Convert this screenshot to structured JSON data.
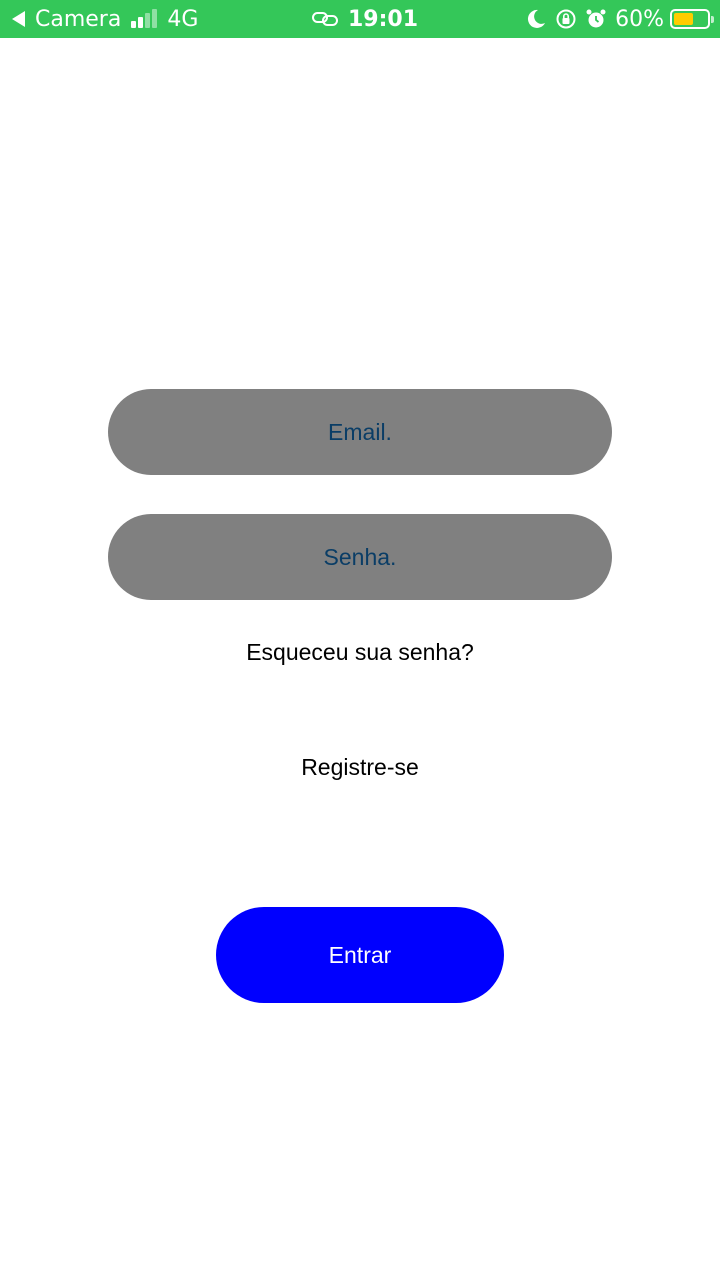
{
  "status_bar": {
    "back_app": "Camera",
    "network": "4G",
    "time": "19:01",
    "battery_percent": "60%",
    "battery_level": 0.6,
    "background_color": "#34c759",
    "battery_color": "#ffcc00",
    "icons": [
      "back-arrow-icon",
      "signal-icon",
      "link-icon",
      "moon-icon",
      "rotation-lock-icon",
      "alarm-icon",
      "battery-icon"
    ]
  },
  "login": {
    "email_placeholder": "Email.",
    "password_placeholder": "Senha.",
    "forgot_password": "Esqueceu sua senha?",
    "register": "Registre-se",
    "submit_label": "Entrar",
    "field_color": "#808080",
    "placeholder_color": "#0a3d66",
    "button_color": "#0000ff"
  }
}
